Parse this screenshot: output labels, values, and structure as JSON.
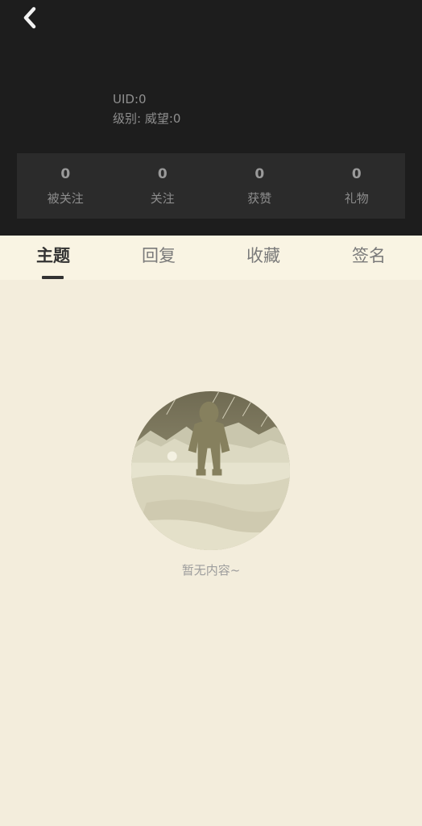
{
  "header": {
    "back_icon": "chevron-left-icon",
    "uid_text": "UID:0",
    "level_text": "级别: 威望:0"
  },
  "stats": [
    {
      "value": "0",
      "label": "被关注"
    },
    {
      "value": "0",
      "label": "关注"
    },
    {
      "value": "0",
      "label": "获赞"
    },
    {
      "value": "0",
      "label": "礼物"
    }
  ],
  "tabs": [
    {
      "label": "主题",
      "active": true
    },
    {
      "label": "回复",
      "active": false
    },
    {
      "label": "收藏",
      "active": false
    },
    {
      "label": "签名",
      "active": false
    }
  ],
  "empty_state": {
    "illustration": "astronaut-empty-illustration",
    "text": "暂无内容~"
  },
  "colors": {
    "header_bg": "#1d1d1d",
    "stats_bg": "#2b2b2b",
    "tab_bar_bg": "#f9f4e3",
    "page_bg": "#f3eddc",
    "active_tab": "#333333",
    "inactive_tab": "#7a7a7a"
  }
}
